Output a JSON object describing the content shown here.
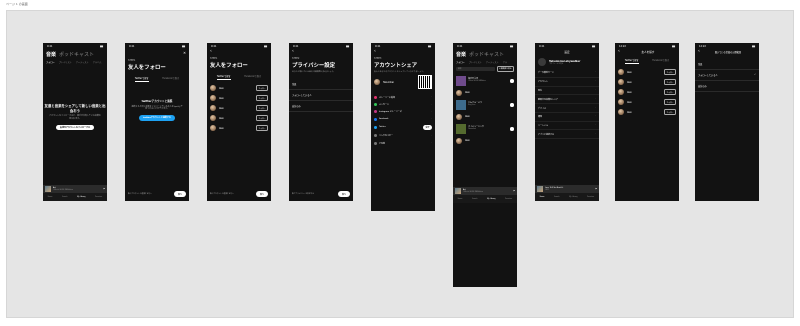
{
  "canvas": {
    "label": "ページ 1 の画面"
  },
  "p1": {
    "title_music": "音楽",
    "title_podcast": "ポッドキャスト",
    "tabs": [
      "フォロー",
      "プレイリスト",
      "アーティスト",
      "アルバム"
    ],
    "headline": "友達と音楽をシェアして新しい音楽と出会おう",
    "sub": "アカウントをフォローすると、相手が共有している音楽を見られます。",
    "cta": "友達のアカウントをフォローする",
    "player_title": "Art",
    "player_sub": "Official HIGE DANdism",
    "nav": [
      "Home",
      "Search",
      "My Library",
      "Premium"
    ]
  },
  "p2": {
    "step": "STEP1",
    "title": "友人をフォロー",
    "tab_on": "Twitterで探す",
    "tab_off": "Facebookで探す",
    "connect_title": "twitterアカウントと連携",
    "connect_sub": "連携すると同じ音楽をフォローしている友人をSpotifyで見つけることができます。",
    "connect_btn": "twitterアカウントと連携する",
    "skip": "後にアカウントと連携する方へ",
    "next": "次へ"
  },
  "p3": {
    "step": "STEP1",
    "title": "友人をフォロー",
    "tab_on": "Twitterで探す",
    "tab_off": "Facebookで探す",
    "friends": [
      "Alex",
      "Alex",
      "Alex",
      "Alex",
      "Alex"
    ],
    "follow": "フォロー",
    "skip": "後にアカウントと連携する方へ",
    "next": "次へ"
  },
  "p4": {
    "step": "STEP2",
    "title": "プライバシー設定",
    "desc": "あなたが聴いている曲の公開範囲を決めましょう。",
    "options": [
      "全員",
      "フォローしている人",
      "自分のみ"
    ],
    "skip": "後でプライバシーを設定する",
    "next": "次へ"
  },
  "p5": {
    "step": "STEP3",
    "title": "アカウントシェア",
    "desc": "友人とあなたのアカウントをシェアしてつながりましょう。",
    "user": "Takumikai",
    "share": [
      {
        "label": "ストーリーに追加",
        "color": "#e1306c"
      },
      {
        "label": "メッセージ",
        "color": "#34c759"
      },
      {
        "label": "Instagram ストーリーズ",
        "color": "#c13584"
      },
      {
        "label": "Facebook",
        "color": "#1877f2"
      },
      {
        "label": "Twitter",
        "color": "#1da1f2"
      },
      {
        "label": "リンクをコピー",
        "color": "#777777"
      },
      {
        "label": "その他",
        "color": "#777777"
      }
    ],
    "next": "完了"
  },
  "p6": {
    "title_music": "音楽",
    "title_podcast": "ポッドキャスト",
    "tabs": [
      "フォロー",
      "プレイリスト",
      "アーティスト",
      "アル"
    ],
    "search_placeholder": "検索",
    "filter": "公開範囲を絞る",
    "items": [
      {
        "title": "海が不えま",
        "sub": "Official HIGE DANdism",
        "color": "#6f4b8c"
      },
      {
        "title": "Alex",
        "sub": "",
        "color": "#8a6a4e"
      },
      {
        "title": "エムバル・ミラ",
        "sub": "King Gnu",
        "color": "#3d6b8c"
      },
      {
        "title": "Alex",
        "sub": "",
        "color": "#8a6a4e"
      },
      {
        "title": "マイミュージック",
        "sub": "Takumikai",
        "color": "#556b2f"
      },
      {
        "title": "Alex",
        "sub": "",
        "color": "#8a6a4e"
      }
    ],
    "player_title": "Art",
    "player_sub": "Official HIGE DANdism",
    "nav": [
      "Home",
      "Search",
      "My Library",
      "Premium"
    ]
  },
  "p7": {
    "header": "設定",
    "name": "Takumi.kai.skywalker",
    "sub": "プロフィールを見る",
    "items": [
      "データ節約モード",
      "アカウント",
      "再生",
      "聴取中の音楽をシェア",
      "デバイス",
      "通知",
      "ソーシャル",
      "アプリと接続する"
    ],
    "player_title": "Love Trill Ver.Beat.ft.",
    "player_sub": "LEXI",
    "nav": [
      "Home",
      "Search",
      "My Library",
      "Premium"
    ]
  },
  "p8": {
    "title": "友人を探す",
    "tab_on": "Twitterで探す",
    "tab_off": "Facebookで探す",
    "friends": [
      "Alex",
      "Alex",
      "Alex",
      "Alex",
      "Alex"
    ],
    "follow": "フォロー"
  },
  "p9": {
    "title": "聴いている音楽の公開範囲",
    "options": [
      "全員",
      "フォローしている人",
      "自分のみ"
    ]
  }
}
